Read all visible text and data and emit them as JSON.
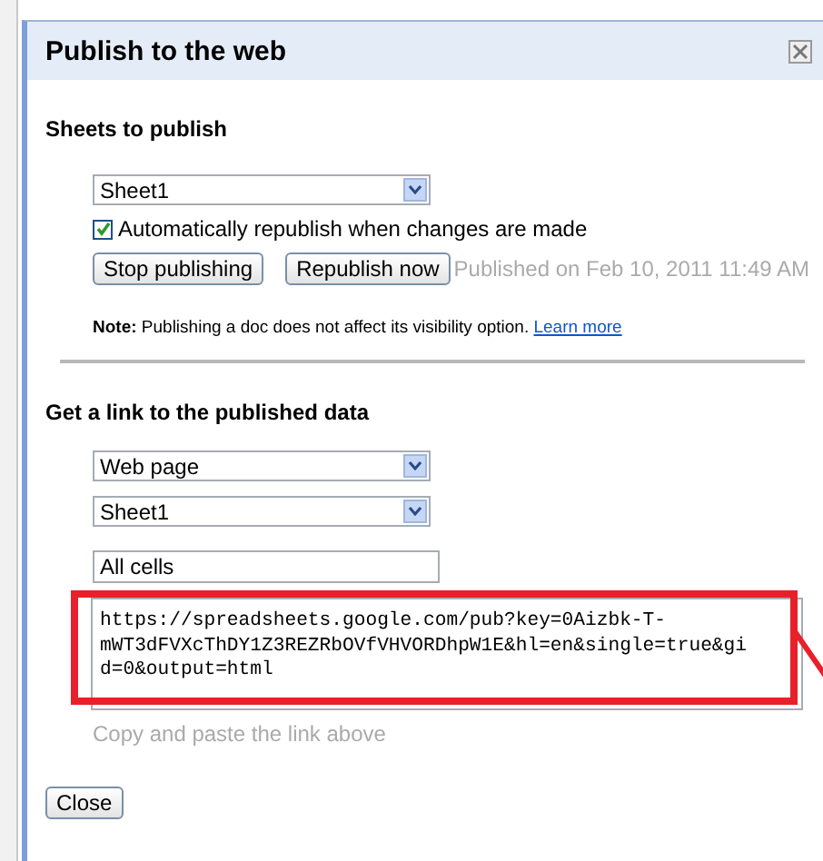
{
  "window": {
    "title": "Publish to the web"
  },
  "sheets_section": {
    "heading": "Sheets to publish",
    "sheet_select": {
      "value": "Sheet1"
    },
    "auto_republish": {
      "label": "Automatically republish when changes are made",
      "checked": true
    },
    "buttons": [
      "Stop publishing",
      "Republish now"
    ],
    "published_status": "Published on Feb 10, 2011 11:49 AM",
    "note": {
      "text": "**Note:** Publishing a doc does not affect its visibility option.",
      "link": "Learn more"
    }
  },
  "link_section": {
    "heading": "Get a link to the published data",
    "format_select": {
      "value": "Web page"
    },
    "sheet_select": {
      "value": "Sheet1"
    },
    "range_field": {
      "value": "All cells"
    },
    "link_field": {
      "value": "https://spreadsheets.google.com/pub?key=0Aizbk-T-mWT3dFVXcThDY1Z3REZRbOVfVHVORDhpW1E&hl=en&single=true&gid=0&output=html"
    },
    "hint": "Copy and paste the link above"
  },
  "footer_buttons": [
    "Close"
  ]
}
